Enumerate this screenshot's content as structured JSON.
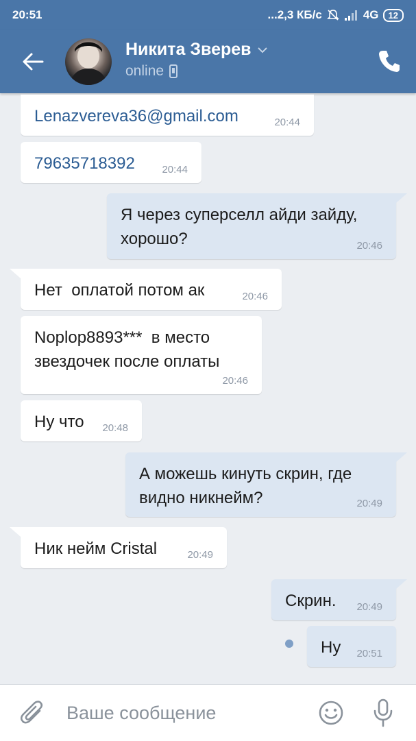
{
  "status_bar": {
    "time": "20:51",
    "network": "...2,3 КБ/с",
    "network_type": "4G",
    "battery": "12"
  },
  "header": {
    "contact_name": "Никита Зверев",
    "presence": "online"
  },
  "messages": [
    {
      "text": "Lenazvereva36@gmail.com",
      "time": "20:44",
      "direction": "in"
    },
    {
      "text": "79635718392",
      "time": "20:44",
      "direction": "in"
    },
    {
      "text": "Я через суперселл айди зайду, хорошо?",
      "time": "20:46",
      "direction": "out"
    },
    {
      "text": "Нет  оплатой потом ак",
      "time": "20:46",
      "direction": "in"
    },
    {
      "text": "Noplop8893***  в место звездочек после оплаты",
      "time": "20:46",
      "direction": "in"
    },
    {
      "text": "Ну что",
      "time": "20:48",
      "direction": "in"
    },
    {
      "text": "А можешь кинуть скрин, где видно никнейм?",
      "time": "20:49",
      "direction": "out"
    },
    {
      "text": "Ник нейм Cristal",
      "time": "20:49",
      "direction": "in"
    },
    {
      "text": "Скрин.",
      "time": "20:49",
      "direction": "out"
    },
    {
      "text": "Ну",
      "time": "20:51",
      "direction": "out",
      "unread": true
    }
  ],
  "composer": {
    "placeholder": "Ваше сообщение"
  },
  "colors": {
    "header": "#4a76a8",
    "background": "#ebeef2",
    "incoming_bubble": "#ffffff",
    "outgoing_bubble": "#dce6f2",
    "link": "#2b5c93"
  },
  "icons": [
    "back-arrow-icon",
    "phone-icon",
    "chevron-down-icon",
    "mobile-device-icon",
    "attach-icon",
    "emoji-icon",
    "microphone-icon",
    "silent-bell-icon",
    "signal-icon"
  ]
}
